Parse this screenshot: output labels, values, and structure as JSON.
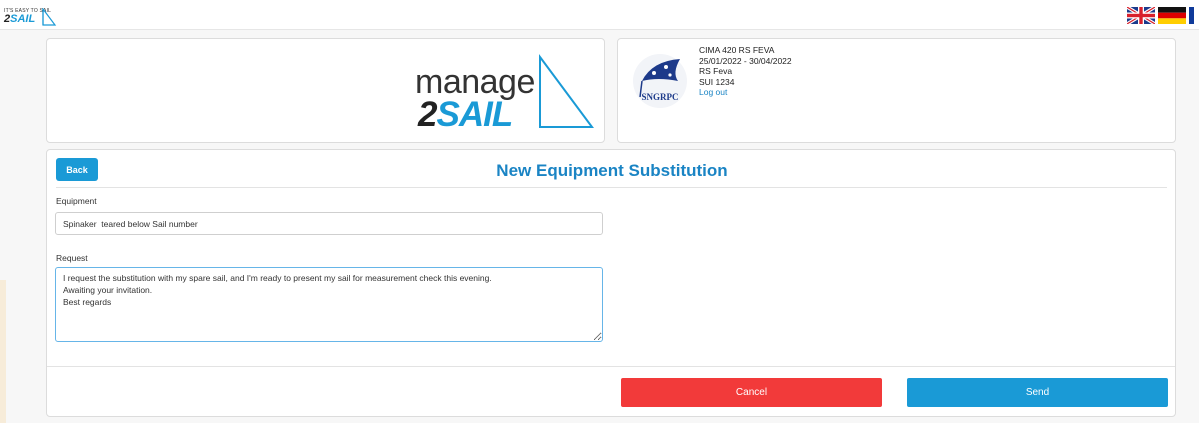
{
  "header": {
    "small_logo_tagline": "IT'S EASY TO SAIL",
    "small_logo_two": "2",
    "small_logo_sail": "SAIL",
    "languages": [
      "uk-flag-icon",
      "de-flag-icon",
      "fr-flag-icon"
    ]
  },
  "brand": {
    "manage": "manage",
    "two": "2",
    "sail": "SAIL"
  },
  "event": {
    "club_label": "SNGRPC",
    "name": "CIMA 420 RS FEVA",
    "dates": "25/01/2022 - 30/04/2022",
    "class": "RS Feva",
    "sail_number": "SUI 1234",
    "logout": "Log out"
  },
  "form": {
    "back_label": "Back",
    "title": "New Equipment Substitution",
    "equipment_label": "Equipment",
    "equipment_value": "Spinaker  teared below Sail number",
    "request_label": "Request",
    "request_value": "I request the substitution with my spare sail, and I'm ready to present my sail for measurement check this evening.\nAwaiting your invitation.\nBest regards",
    "cancel_label": "Cancel",
    "send_label": "Send"
  },
  "colors": {
    "accent": "#1a9ad6",
    "title": "#1a84c4",
    "cancel": "#f23a3a"
  }
}
